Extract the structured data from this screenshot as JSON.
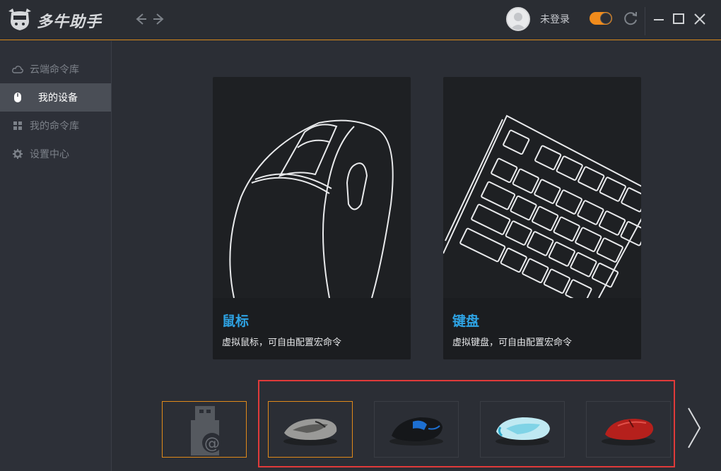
{
  "app": {
    "name": "多牛助手"
  },
  "header": {
    "login_text": "未登录",
    "accent": "#f08b1c"
  },
  "sidebar": {
    "items": [
      {
        "label": "云端命令库",
        "icon": "cloud-icon",
        "active": false
      },
      {
        "label": "我的设备",
        "icon": "mouse-icon",
        "active": true
      },
      {
        "label": "我的命令库",
        "icon": "grid-icon",
        "active": false
      },
      {
        "label": "设置中心",
        "icon": "gear-icon",
        "active": false
      }
    ]
  },
  "cards": {
    "mouse": {
      "title": "鼠标",
      "desc": "虚拟鼠标，可自由配置宏命令"
    },
    "keyboard": {
      "title": "键盘",
      "desc": "虚拟键盘，可自由配置宏命令"
    }
  },
  "devices": {
    "usb_icon": "usb-icon",
    "items": [
      {
        "icon": "mouse-gray-icon",
        "selected": true,
        "color": "#8a8a8a"
      },
      {
        "icon": "mouse-black-blue-icon",
        "selected": false,
        "color": "#1d6fd1"
      },
      {
        "icon": "mouse-light-blue-icon",
        "selected": false,
        "color": "#7fd3e6"
      },
      {
        "icon": "mouse-red-icon",
        "selected": false,
        "color": "#b5201c"
      }
    ]
  },
  "colors": {
    "card_title": "#2ea3e4",
    "highlight": "#e03a3a",
    "selected_border": "#e08a1a"
  }
}
